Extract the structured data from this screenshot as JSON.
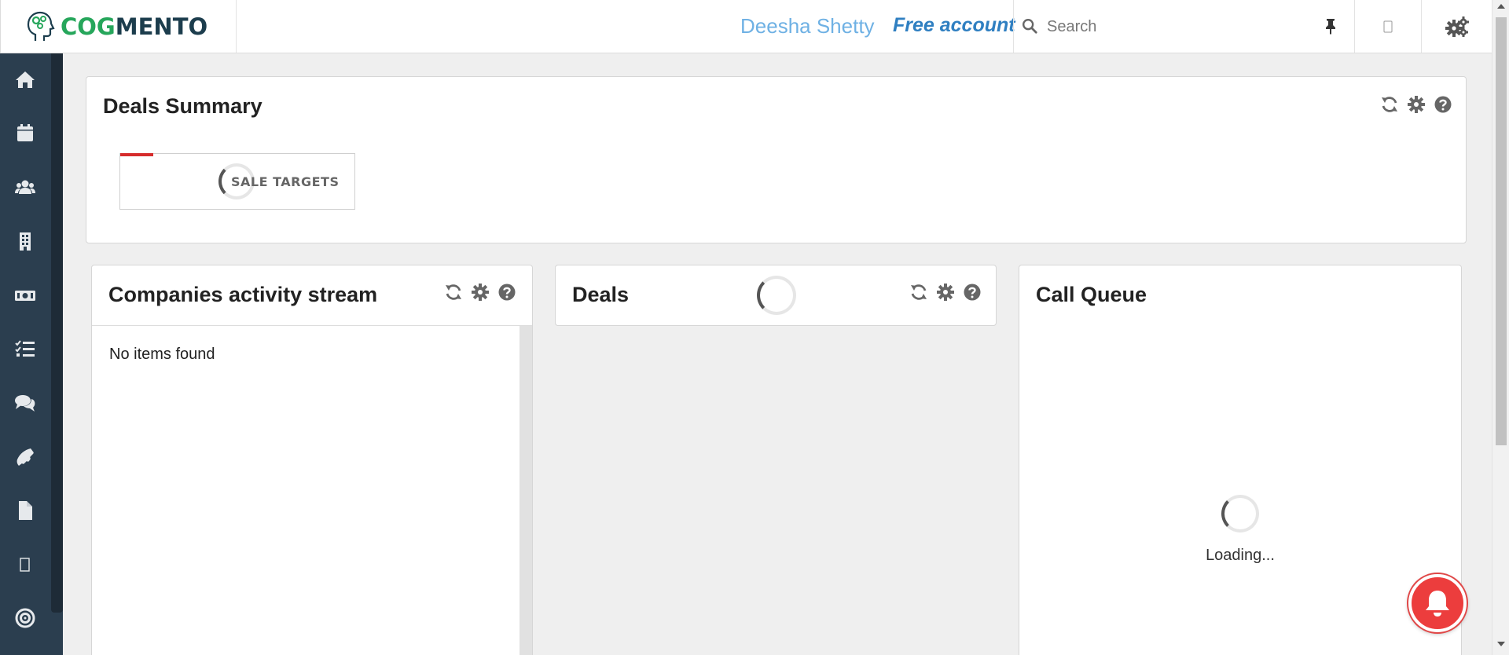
{
  "header": {
    "logo": {
      "cog": "COG",
      "mento": "MENTO"
    },
    "user_name": "Deesha Shetty",
    "account_type": "Free account",
    "search": {
      "placeholder": "Search",
      "value": ""
    },
    "icons": [
      "brain-logo-icon",
      "search-icon",
      "pin-icon",
      "mobile-icon",
      "settings-gears-icon"
    ]
  },
  "sidebar": {
    "items": [
      {
        "name": "home",
        "icon": "home-icon"
      },
      {
        "name": "calendar",
        "icon": "calendar-icon"
      },
      {
        "name": "contacts",
        "icon": "users-icon"
      },
      {
        "name": "companies",
        "icon": "building-icon"
      },
      {
        "name": "deals",
        "icon": "money-icon"
      },
      {
        "name": "tasks",
        "icon": "tasks-icon"
      },
      {
        "name": "cases",
        "icon": "comments-icon"
      },
      {
        "name": "calls",
        "icon": "phone-icon"
      },
      {
        "name": "documents",
        "icon": "file-icon"
      },
      {
        "name": "unknown",
        "icon": "blank-glyph-icon"
      },
      {
        "name": "campaigns",
        "icon": "target-icon"
      }
    ]
  },
  "deals_summary": {
    "title": "Deals Summary",
    "card_label": "SALE TARGETS",
    "tools": [
      "refresh-icon",
      "settings-icon",
      "help-icon"
    ]
  },
  "companies_stream": {
    "title": "Companies activity stream",
    "empty_text": "No items found"
  },
  "deals": {
    "title": "Deals"
  },
  "call_queue": {
    "title": "Call Queue",
    "loading_text": "Loading..."
  },
  "colors": {
    "sidebar_bg": "#2b3e4f",
    "logo_green": "#26a65b",
    "logo_dark": "#1c3d4d",
    "user_name": "#6fb1e4",
    "account_type": "#2f7fc1",
    "bell_red": "#ec3d3d"
  }
}
